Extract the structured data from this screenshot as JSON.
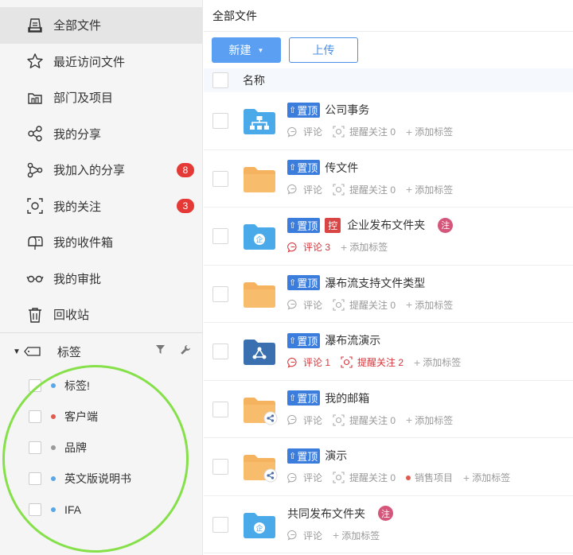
{
  "sidebar": {
    "items": [
      {
        "label": "全部文件",
        "icon": "all-files-icon",
        "active": true
      },
      {
        "label": "最近访问文件",
        "icon": "star-icon"
      },
      {
        "label": "部门及项目",
        "icon": "department-icon"
      },
      {
        "label": "我的分享",
        "icon": "share-icon"
      },
      {
        "label": "我加入的分享",
        "icon": "joined-share-icon",
        "badge": "8"
      },
      {
        "label": "我的关注",
        "icon": "follow-icon",
        "badge": "3"
      },
      {
        "label": "我的收件箱",
        "icon": "mailbox-icon"
      },
      {
        "label": "我的审批",
        "icon": "approval-icon"
      },
      {
        "label": "回收站",
        "icon": "trash-icon"
      }
    ],
    "tags_title": "标签",
    "tags": [
      {
        "label": "标签!",
        "color": "#5aa7e8"
      },
      {
        "label": "客户端",
        "color": "#e05a4e"
      },
      {
        "label": "品牌",
        "color": "#9a9a9a"
      },
      {
        "label": "英文版说明书",
        "color": "#5aa7e8"
      },
      {
        "label": "IFA",
        "color": "#5aa7e8"
      }
    ]
  },
  "main": {
    "breadcrumb": "全部文件",
    "new_label": "新建",
    "new_arrow": "▼",
    "upload_label": "上传",
    "column_name": "名称",
    "pin_text": "置顶",
    "pin_arrow": "⇧",
    "ctrl_text": "控",
    "note_text": "注",
    "rows": [
      {
        "name": "公司事务",
        "folder": "org",
        "pinned": true,
        "meta": [
          {
            "t": "评论",
            "i": "comment"
          },
          {
            "t": "提醒关注 0",
            "i": "remind"
          },
          {
            "t": "添加标签",
            "i": "plus"
          }
        ]
      },
      {
        "name": "传文件",
        "folder": "plain",
        "pinned": true,
        "meta": [
          {
            "t": "评论",
            "i": "comment"
          },
          {
            "t": "提醒关注 0",
            "i": "remind"
          },
          {
            "t": "添加标签",
            "i": "plus"
          }
        ]
      },
      {
        "name": "企业发布文件夹",
        "folder": "enterprise",
        "pinned": true,
        "ctrl": true,
        "note": true,
        "meta": [
          {
            "t": "评论 3",
            "i": "comment",
            "red": true
          },
          {
            "t": "添加标签",
            "i": "plus"
          }
        ]
      },
      {
        "name": "瀑布流支持文件类型",
        "folder": "plain",
        "pinned": true,
        "meta": [
          {
            "t": "评论",
            "i": "comment"
          },
          {
            "t": "提醒关注 0",
            "i": "remind"
          },
          {
            "t": "添加标签",
            "i": "plus"
          }
        ]
      },
      {
        "name": "瀑布流演示",
        "folder": "nodes",
        "pinned": true,
        "meta": [
          {
            "t": "评论 1",
            "i": "comment",
            "red": true
          },
          {
            "t": "提醒关注 2",
            "i": "remind",
            "red": true
          },
          {
            "t": "添加标签",
            "i": "plus"
          }
        ]
      },
      {
        "name": "我的邮箱",
        "folder": "shared",
        "pinned": true,
        "meta": [
          {
            "t": "评论",
            "i": "comment"
          },
          {
            "t": "提醒关注 0",
            "i": "remind"
          },
          {
            "t": "添加标签",
            "i": "plus"
          }
        ]
      },
      {
        "name": "演示",
        "folder": "shared",
        "pinned": true,
        "meta": [
          {
            "t": "评论",
            "i": "comment"
          },
          {
            "t": "提醒关注 0",
            "i": "remind"
          },
          {
            "t": "销售项目",
            "i": "tagdot"
          },
          {
            "t": "添加标签",
            "i": "plus"
          }
        ]
      },
      {
        "name": "共同发布文件夹",
        "folder": "enterprise",
        "pinned": false,
        "note": true,
        "meta": [
          {
            "t": "评论",
            "i": "comment"
          },
          {
            "t": "添加标签",
            "i": "plus"
          }
        ]
      }
    ]
  }
}
